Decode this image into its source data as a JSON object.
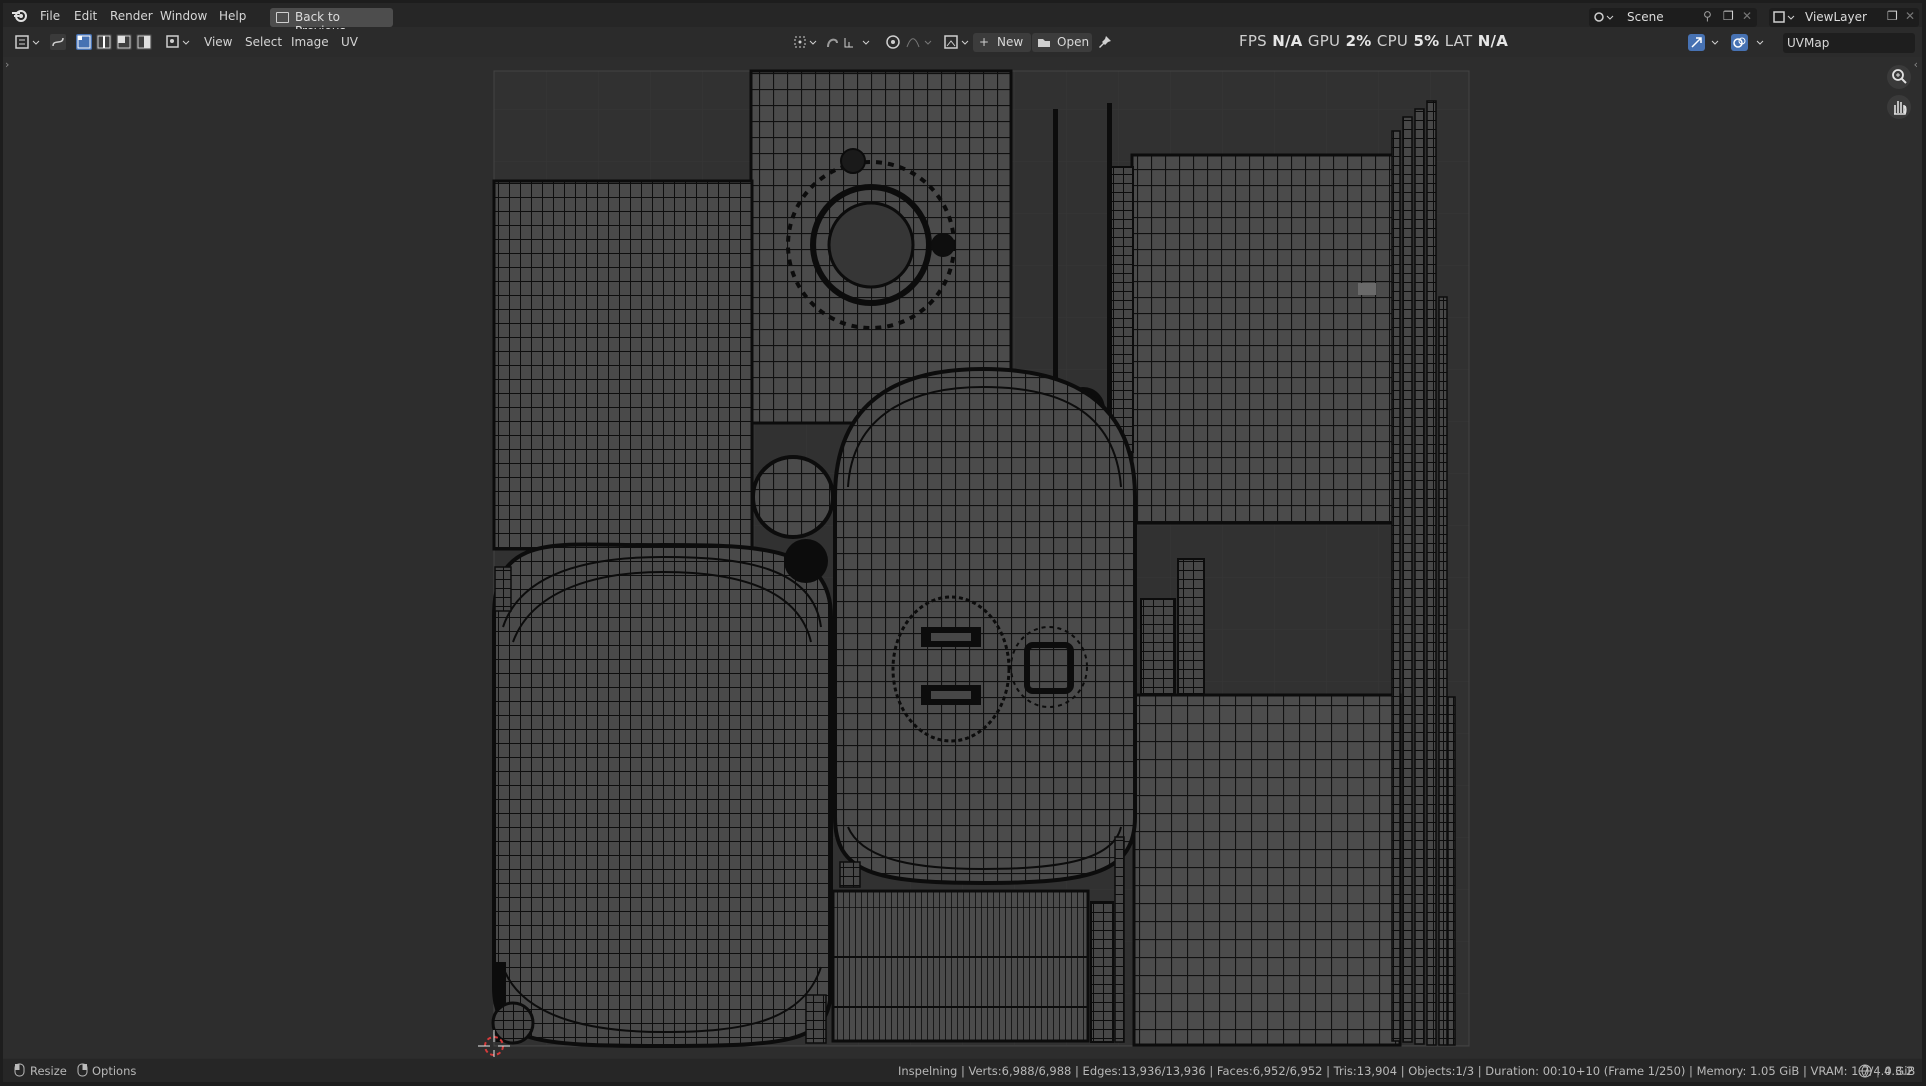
{
  "menu": {
    "items": [
      "File",
      "Edit",
      "Render",
      "Window",
      "Help"
    ],
    "back_button": "Back to Previous"
  },
  "workspace": {
    "scene": "Scene",
    "view_layer": "ViewLayer"
  },
  "header": {
    "menus": [
      "View",
      "Select",
      "Image",
      "UV"
    ],
    "new_label": "New",
    "open_label": "Open",
    "uv_map": "UVMap"
  },
  "perf": {
    "fps_label": "FPS",
    "fps_value": "N/A",
    "gpu_label": "GPU",
    "gpu_value": "2%",
    "cpu_label": "CPU",
    "cpu_value": "5%",
    "lat_label": "LAT",
    "lat_value": "N/A"
  },
  "status": {
    "resize": "Resize",
    "options": "Options",
    "info": "Inspelning | Verts:6,988/6,988 | Edges:13,936/13,936 | Faces:6,952/6,952 | Tris:13,904 | Objects:1/3 | Duration: 00:10+10 (Frame 1/250) | Memory: 1.05 GiB | VRAM: 1.7/4.0 GiB",
    "version": "4.3.2"
  },
  "icons": {
    "app": "blender-logo-icon",
    "editor": "uv-editor-icon",
    "zoom": "zoom-icon",
    "pan": "hand-icon",
    "pin": "pin-icon"
  },
  "colors": {
    "background": "#2b2b2b",
    "uv_face": "#4a4a4a",
    "uv_edge": "#0c0c0c",
    "accent_blue": "#4772b3"
  }
}
